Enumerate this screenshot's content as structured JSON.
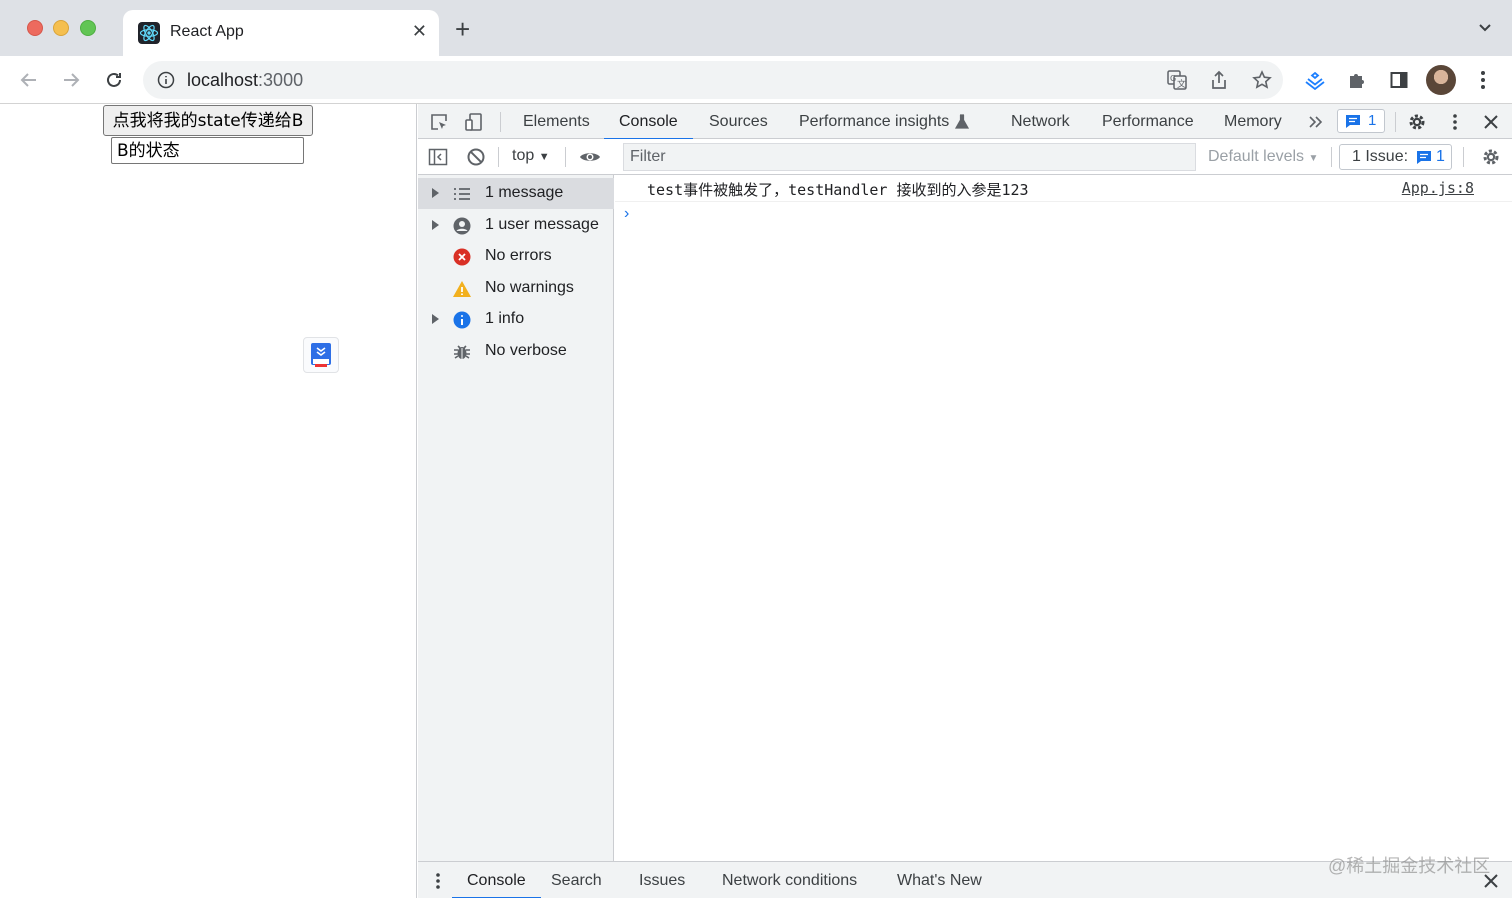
{
  "browser": {
    "tab_title": "React App",
    "url_host": "localhost",
    "url_port": ":3000"
  },
  "page": {
    "button_label": "点我将我的state传递给B",
    "input_value": "B的状态"
  },
  "devtools": {
    "tabs": [
      "Elements",
      "Console",
      "Sources",
      "Performance insights",
      "Network",
      "Performance",
      "Memory"
    ],
    "active_tab": "Console",
    "message_count": "1",
    "context": "top",
    "filter_placeholder": "Filter",
    "levels": "Default levels",
    "issues_label": "1 Issue:",
    "issues_count": "1",
    "sidebar": [
      {
        "label": "1 message",
        "icon": "list-icon"
      },
      {
        "label": "1 user message",
        "icon": "user-icon"
      },
      {
        "label": "No errors",
        "icon": "error-icon"
      },
      {
        "label": "No warnings",
        "icon": "warning-icon"
      },
      {
        "label": "1 info",
        "icon": "info-icon"
      },
      {
        "label": "No verbose",
        "icon": "bug-icon"
      }
    ],
    "log": {
      "text": "test事件被触发了，testHandler 接收到的入参是123",
      "source": "App.js:8"
    },
    "drawer_tabs": [
      "Console",
      "Search",
      "Issues",
      "Network conditions",
      "What's New"
    ]
  },
  "watermark": "@稀土掘金技术社区",
  "colors": {
    "accent": "#1a73e8",
    "error": "#d93025",
    "warning": "#f2b01e",
    "info": "#1a73e8"
  }
}
